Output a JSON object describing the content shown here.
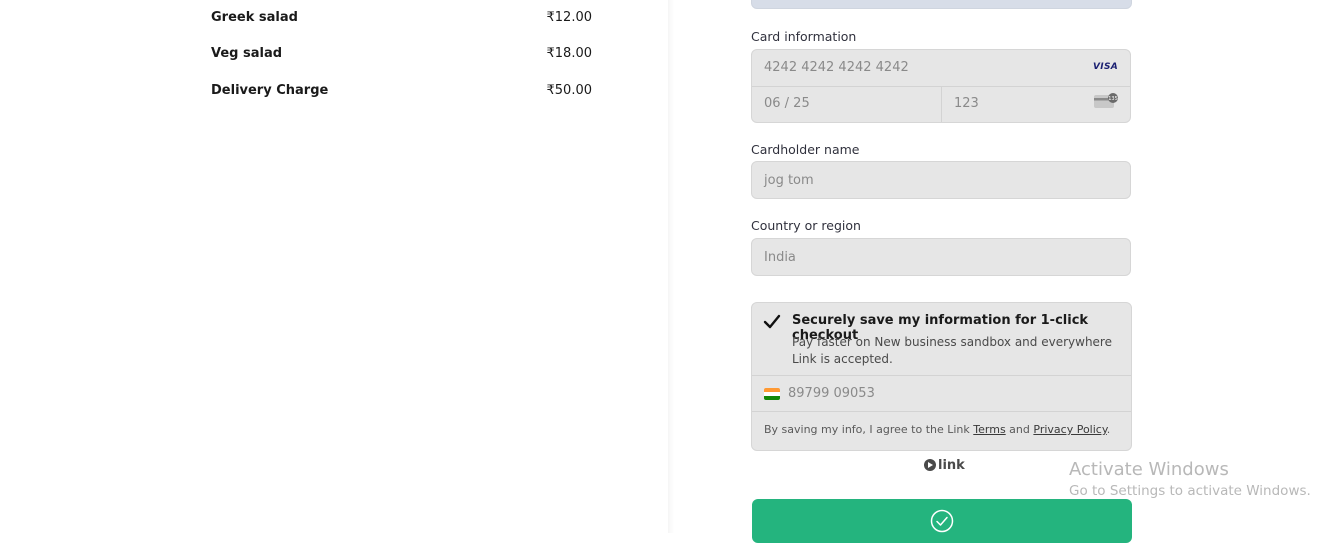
{
  "order_items": [
    {
      "name": "Greek salad",
      "price": "₹12.00"
    },
    {
      "name": "Veg salad",
      "price": "₹18.00"
    },
    {
      "name": "Delivery Charge",
      "price": "₹50.00"
    }
  ],
  "payment": {
    "card_info_label": "Card information",
    "card_number": "4242 4242 4242 4242",
    "card_brand": "VISA",
    "expiry": "06 / 25",
    "cvc": "123",
    "cardholder_label": "Cardholder name",
    "cardholder_value": "jog tom",
    "country_label": "Country or region",
    "country_value": "India"
  },
  "link_save": {
    "title": "Securely save my information for 1-click checkout",
    "description": "Pay faster on New business sandbox and everywhere Link is accepted.",
    "phone": "89799 09053",
    "legal_prefix": "By saving my info, I agree to the Link ",
    "terms": "Terms",
    "and": " and ",
    "privacy": "Privacy Policy",
    "legal_suffix": ".",
    "checked": true
  },
  "link_brand": "link",
  "colors": {
    "pay_button": "#24b47e",
    "field_bg": "#e6e6e6"
  },
  "watermark": {
    "title": "Activate Windows",
    "subtitle": "Go to Settings to activate Windows."
  }
}
